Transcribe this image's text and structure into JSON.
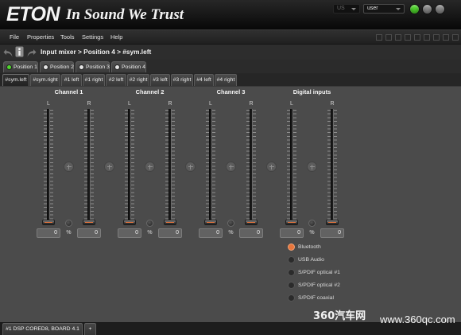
{
  "header": {
    "logo": {
      "brand": "ETON",
      "tagline": "In Sound We Trust"
    },
    "region_select": {
      "value": "US"
    },
    "user_select": {
      "value": "user"
    },
    "indicators": [
      {
        "color": "#4fd62c"
      },
      {
        "color": "#8c8c8c"
      },
      {
        "color": "#8c8c8c"
      }
    ]
  },
  "menu": {
    "items": [
      "File",
      "Properties",
      "Tools",
      "Settings",
      "Help"
    ]
  },
  "toolbar": {
    "icons": [
      "undo-icon",
      "info-icon",
      "redo-icon"
    ],
    "breadcrumb": "Input mixer > Position 4 > #sym.left"
  },
  "position_tabs": {
    "items": [
      {
        "label": "Position 1",
        "dot_color": "#4fd62c"
      },
      {
        "label": "Position 2",
        "dot_color": "#e4e4e4"
      },
      {
        "label": "Position 3",
        "dot_color": "#e4e4e4"
      },
      {
        "label": "Position 4",
        "dot_color": "#e4e4e4"
      }
    ]
  },
  "channel_tabs": {
    "items": [
      {
        "label": "#sym.left",
        "active": true
      },
      {
        "label": "#sym.right",
        "active": false
      },
      {
        "label": "#1 left",
        "active": false
      },
      {
        "label": "#1 right",
        "active": false
      },
      {
        "label": "#2 left",
        "active": false
      },
      {
        "label": "#2 right",
        "active": false
      },
      {
        "label": "#3 left",
        "active": false
      },
      {
        "label": "#3 right",
        "active": false
      },
      {
        "label": "#4 left",
        "active": false
      },
      {
        "label": "#4 right",
        "active": false
      }
    ]
  },
  "mixer": {
    "groups": [
      {
        "title": "Channel 1",
        "unit": "%",
        "left": {
          "label": "L",
          "value": "0",
          "level": 0
        },
        "right": {
          "label": "R",
          "value": "0",
          "level": 0
        }
      },
      {
        "title": "Channel 2",
        "unit": "%",
        "left": {
          "label": "L",
          "value": "0",
          "level": 0
        },
        "right": {
          "label": "R",
          "value": "0",
          "level": 0
        }
      },
      {
        "title": "Channel 3",
        "unit": "%",
        "left": {
          "label": "L",
          "value": "0",
          "level": 0
        },
        "right": {
          "label": "R",
          "value": "0",
          "level": 0
        }
      },
      {
        "title": "Digital inputs",
        "unit": "%",
        "left": {
          "label": "L",
          "value": "0",
          "level": 0
        },
        "right": {
          "label": "R",
          "value": "0",
          "level": 0
        }
      }
    ]
  },
  "digital_inputs": {
    "options": [
      {
        "label": "Bluetooth",
        "selected": true
      },
      {
        "label": "USB Audio",
        "selected": false
      },
      {
        "label": "S/PDIF optical #1",
        "selected": false
      },
      {
        "label": "S/PDIF optical #2",
        "selected": false
      },
      {
        "label": "S/PDIF coaxial",
        "selected": false
      }
    ]
  },
  "status_bar": {
    "tabs": [
      {
        "label": "#1 DSP CORED8, BOARD 4.1"
      }
    ],
    "add_tab_label": "+"
  },
  "watermark": {
    "brand": "360汽车网",
    "url": "www.360qc.com"
  },
  "theme": {
    "accent": "#e8763c",
    "panel": "#4b4b4b",
    "status_green": "#4fd62c"
  }
}
